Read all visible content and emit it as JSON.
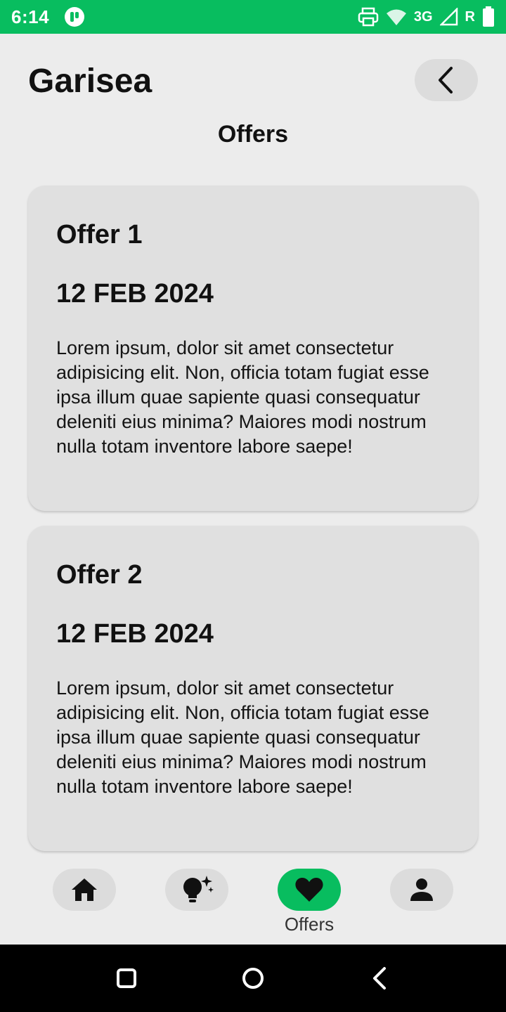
{
  "status_bar": {
    "time": "6:14",
    "network": "3G",
    "roaming": "R",
    "accent_color": "#08bd5f",
    "icons": [
      "app-icon",
      "print-icon",
      "wifi-icon",
      "signal-icon",
      "battery-icon"
    ]
  },
  "header": {
    "app_title": "Garisea",
    "page_title": "Offers",
    "back_icon": "chevron-left-icon"
  },
  "offers": [
    {
      "name": "Offer 1",
      "date": "12 FEB 2024",
      "description": "Lorem ipsum, dolor sit amet consectetur adipisicing elit. Non, officia totam fugiat esse ipsa illum quae sapiente quasi consequatur deleniti eius minima? Maiores modi nostrum nulla totam inventore labore saepe!"
    },
    {
      "name": "Offer 2",
      "date": "12 FEB 2024",
      "description": "Lorem ipsum, dolor sit amet consectetur adipisicing elit. Non, officia totam fugiat esse ipsa illum quae sapiente quasi consequatur deleniti eius minima? Maiores modi nostrum nulla totam inventore labore saepe!"
    }
  ],
  "bottom_nav": {
    "items": [
      {
        "icon": "home-icon",
        "active": false
      },
      {
        "icon": "lightbulb-sparkle-icon",
        "active": false
      },
      {
        "icon": "heart-icon",
        "active": true,
        "label": "Offers"
      },
      {
        "icon": "person-icon",
        "active": false
      }
    ],
    "active_color": "#08bd5f"
  },
  "system_nav": {
    "icons": [
      "recents-square-icon",
      "home-circle-icon",
      "back-triangle-icon"
    ]
  }
}
